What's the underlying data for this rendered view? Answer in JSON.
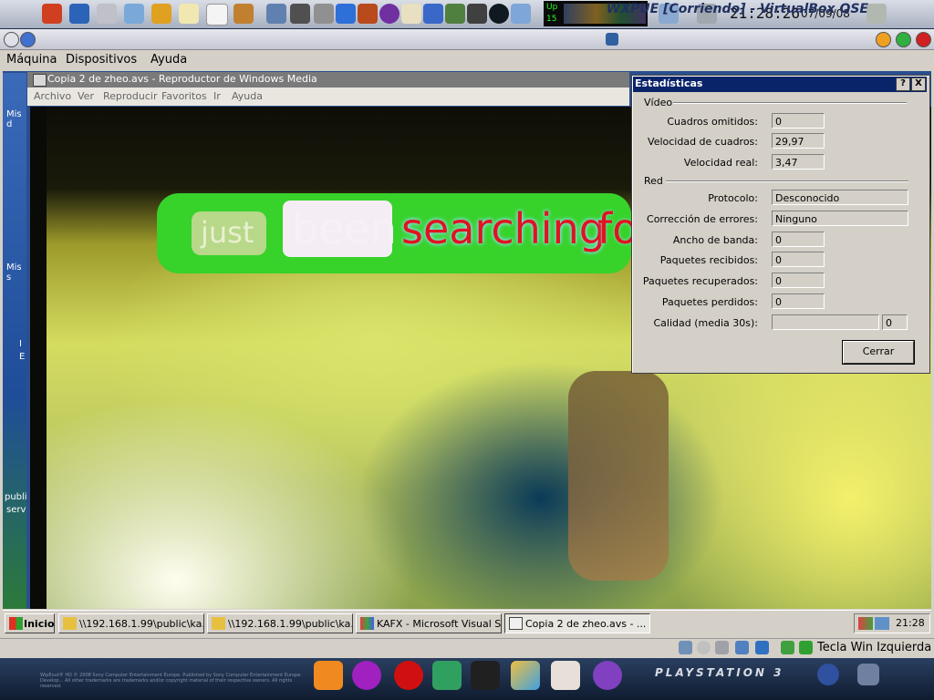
{
  "host_panel": {
    "clock": "21:28:26",
    "date": "07/09/08",
    "monitor_labels": [
      "Up",
      "15"
    ],
    "icons": [
      "rocket-icon",
      "home-icon",
      "printer-icon",
      "network-icon",
      "download-icon",
      "notes-icon",
      "blank-icon",
      "wrench-icon",
      "usb-icon",
      "disk-icon",
      "camera-icon",
      "arrow-down-icon",
      "gift-icon",
      "x-circle-icon",
      "k-icon",
      "window-icon",
      "contacts-icon",
      "headset-icon",
      "rec-icon",
      "install-icon"
    ]
  },
  "vbox": {
    "title": "WXPUE [Corriendo] - VirtualBox OSE",
    "menu": [
      "Máquina",
      "Dispositivos",
      "Ayuda"
    ],
    "status_host_key": "Tecla Win Izquierda"
  },
  "desktop_labels": [
    "Mis d",
    "Mis s",
    "I",
    "E",
    "publi",
    "serv"
  ],
  "wmp": {
    "title": "Copia 2 de zheo.avs - Reproductor de Windows Media",
    "menu": [
      "Archivo",
      "Ver",
      "Reproducir",
      "Favoritos",
      "Ir",
      "Ayuda"
    ],
    "subtitle_words": [
      "just",
      "been",
      "searching",
      "fo"
    ]
  },
  "stats": {
    "title": "Estadísticas",
    "help_button": "?",
    "close_x": "X",
    "video_group": "Vídeo",
    "network_group": "Red",
    "rows_video": [
      {
        "label": "Cuadros omitidos:",
        "value": "0"
      },
      {
        "label": "Velocidad de cuadros:",
        "value": "29,97"
      },
      {
        "label": "Velocidad real:",
        "value": "3,47"
      }
    ],
    "rows_network": [
      {
        "label": "Protocolo:",
        "value": "Desconocido"
      },
      {
        "label": "Corrección de errores:",
        "value": "Ninguno"
      },
      {
        "label": "Ancho de banda:",
        "value": "0"
      },
      {
        "label": "Paquetes recibidos:",
        "value": "0"
      },
      {
        "label": "Paquetes recuperados:",
        "value": "0"
      },
      {
        "label": "Paquetes perdidos:",
        "value": "0"
      }
    ],
    "quality_label": "Calidad (media 30s):",
    "quality_value": "0",
    "close_button": "Cerrar"
  },
  "taskbar": {
    "start": "Inicio",
    "tasks": [
      "\\\\192.168.1.99\\public\\ka...",
      "\\\\192.168.1.99\\public\\ka...",
      "KAFX - Microsoft Visual S...",
      "Copia 2 de zheo.avs - ..."
    ],
    "clock": "21:28"
  },
  "dock": {
    "brand": "PLAYSTATION 3",
    "legal": "WipEout® HD © 2008 Sony Computer Entertainment Europe. Published by Sony Computer Entertainment Europe. Develop... All other trademarks are trademarks and/or copyright material of their respective owners. All rights reserved."
  },
  "colors": {
    "stats_title_bg": "#0a246a",
    "subtitle_green": "#37d22a",
    "subtitle_red": "#e0141e"
  }
}
